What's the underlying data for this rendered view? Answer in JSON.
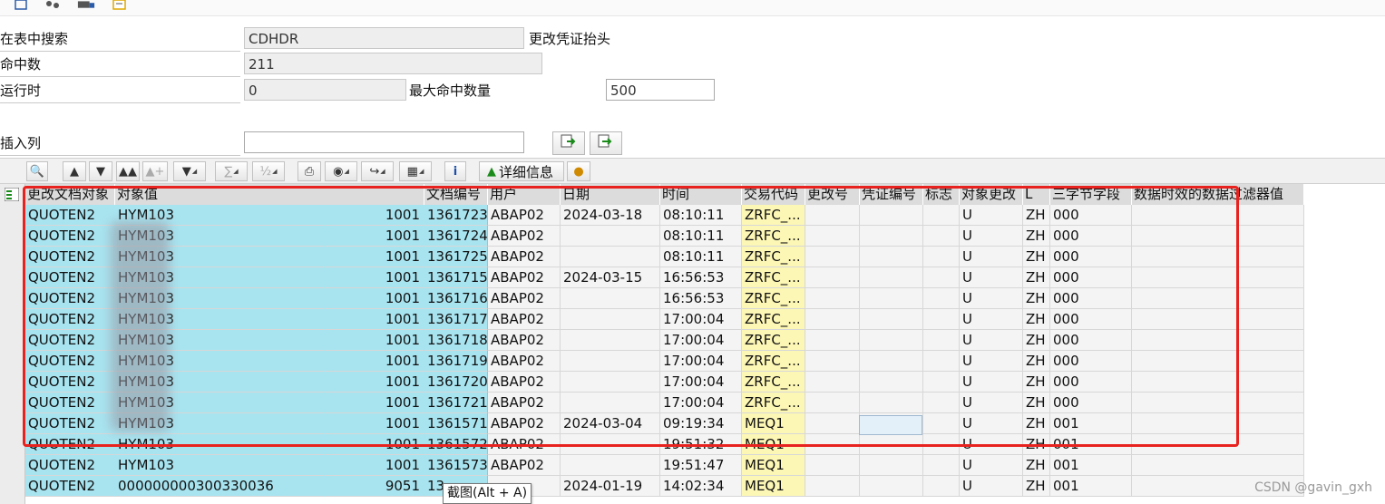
{
  "top_toolbar": {
    "icons": [
      "save-icon",
      "settings-icon",
      "transport-icon",
      "document-icon"
    ]
  },
  "form": {
    "search_table_label": "在表中搜索",
    "search_table_value": "CDHDR",
    "search_table_desc": "更改凭证抬头",
    "hits_label": "命中数",
    "hits_value": "211",
    "runtime_label": "运行时",
    "runtime_value": "0",
    "max_hits_label": "最大命中数量",
    "max_hits_value": "500",
    "insert_col_label": "插入列",
    "insert_col_value": ""
  },
  "alv_toolbar": {
    "buttons": [
      "details-icon",
      "sort-asc-icon",
      "sort-desc-icon",
      "find-icon",
      "find-next-icon",
      "filter-icon",
      "sum-icon",
      "subtotal-icon",
      "print-icon",
      "view-icon",
      "export-icon",
      "layout-icon",
      "info-icon",
      "chart-icon",
      "abc-icon"
    ],
    "details_label": "详细信息"
  },
  "table": {
    "headers": [
      "更改文档对象",
      "对象值",
      "文档编号",
      "用户",
      "日期",
      "时间",
      "交易代码",
      "更改号",
      "凭证编号",
      "标志",
      "对象更改",
      "L",
      "三字节字段",
      "数据时效的数据过滤器值"
    ],
    "rows": [
      {
        "obj": "QUOTEN2",
        "val1": "HYM103",
        "val2": "1001",
        "doc": "1361723",
        "user": "ABAP02",
        "date": "2024-03-18",
        "time": "08:10:11",
        "tcode": "ZRFC_...",
        "chg": "",
        "voucher": "",
        "flag": "",
        "objchg": "U",
        "lang": "ZH",
        "tri": "000",
        "filter": ""
      },
      {
        "obj": "QUOTEN2",
        "val1": "HYM103",
        "val2": "1001",
        "doc": "1361724",
        "user": "ABAP02",
        "date": "",
        "time": "08:10:11",
        "tcode": "ZRFC_...",
        "chg": "",
        "voucher": "",
        "flag": "",
        "objchg": "U",
        "lang": "ZH",
        "tri": "000",
        "filter": ""
      },
      {
        "obj": "QUOTEN2",
        "val1": "HYM103",
        "val2": "1001",
        "doc": "1361725",
        "user": "ABAP02",
        "date": "",
        "time": "08:10:11",
        "tcode": "ZRFC_...",
        "chg": "",
        "voucher": "",
        "flag": "",
        "objchg": "U",
        "lang": "ZH",
        "tri": "000",
        "filter": ""
      },
      {
        "obj": "QUOTEN2",
        "val1": "HYM103",
        "val2": "1001",
        "doc": "1361715",
        "user": "ABAP02",
        "date": "2024-03-15",
        "time": "16:56:53",
        "tcode": "ZRFC_...",
        "chg": "",
        "voucher": "",
        "flag": "",
        "objchg": "U",
        "lang": "ZH",
        "tri": "000",
        "filter": ""
      },
      {
        "obj": "QUOTEN2",
        "val1": "HYM103",
        "val2": "1001",
        "doc": "1361716",
        "user": "ABAP02",
        "date": "",
        "time": "16:56:53",
        "tcode": "ZRFC_...",
        "chg": "",
        "voucher": "",
        "flag": "",
        "objchg": "U",
        "lang": "ZH",
        "tri": "000",
        "filter": ""
      },
      {
        "obj": "QUOTEN2",
        "val1": "HYM103",
        "val2": "1001",
        "doc": "1361717",
        "user": "ABAP02",
        "date": "",
        "time": "17:00:04",
        "tcode": "ZRFC_...",
        "chg": "",
        "voucher": "",
        "flag": "",
        "objchg": "U",
        "lang": "ZH",
        "tri": "000",
        "filter": ""
      },
      {
        "obj": "QUOTEN2",
        "val1": "HYM103",
        "val2": "1001",
        "doc": "1361718",
        "user": "ABAP02",
        "date": "",
        "time": "17:00:04",
        "tcode": "ZRFC_...",
        "chg": "",
        "voucher": "",
        "flag": "",
        "objchg": "U",
        "lang": "ZH",
        "tri": "000",
        "filter": ""
      },
      {
        "obj": "QUOTEN2",
        "val1": "HYM103",
        "val2": "1001",
        "doc": "1361719",
        "user": "ABAP02",
        "date": "",
        "time": "17:00:04",
        "tcode": "ZRFC_...",
        "chg": "",
        "voucher": "",
        "flag": "",
        "objchg": "U",
        "lang": "ZH",
        "tri": "000",
        "filter": ""
      },
      {
        "obj": "QUOTEN2",
        "val1": "HYM103",
        "val2": "1001",
        "doc": "1361720",
        "user": "ABAP02",
        "date": "",
        "time": "17:00:04",
        "tcode": "ZRFC_...",
        "chg": "",
        "voucher": "",
        "flag": "",
        "objchg": "U",
        "lang": "ZH",
        "tri": "000",
        "filter": ""
      },
      {
        "obj": "QUOTEN2",
        "val1": "HYM103",
        "val2": "1001",
        "doc": "1361721",
        "user": "ABAP02",
        "date": "",
        "time": "17:00:04",
        "tcode": "ZRFC_...",
        "chg": "",
        "voucher": "",
        "flag": "",
        "objchg": "U",
        "lang": "ZH",
        "tri": "000",
        "filter": ""
      },
      {
        "obj": "QUOTEN2",
        "val1": "HYM103",
        "val2": "1001",
        "doc": "1361571",
        "user": "ABAP02",
        "date": "2024-03-04",
        "time": "09:19:34",
        "tcode": "MEQ1",
        "chg": "",
        "voucher": "",
        "flag": "",
        "objchg": "U",
        "lang": "ZH",
        "tri": "001",
        "filter": ""
      },
      {
        "obj": "QUOTEN2",
        "val1": "HYM103",
        "val2": "1001",
        "doc": "1361572",
        "user": "ABAP02",
        "date": "",
        "time": "19:51:32",
        "tcode": "MEQ1",
        "chg": "",
        "voucher": "",
        "flag": "",
        "objchg": "U",
        "lang": "ZH",
        "tri": "001",
        "filter": ""
      },
      {
        "obj": "QUOTEN2",
        "val1": "HYM103",
        "val2": "1001",
        "doc": "1361573",
        "user": "ABAP02",
        "date": "",
        "time": "19:51:47",
        "tcode": "MEQ1",
        "chg": "",
        "voucher": "",
        "flag": "",
        "objchg": "U",
        "lang": "ZH",
        "tri": "001",
        "filter": ""
      },
      {
        "obj": "QUOTEN2",
        "val1": "000000000300330036",
        "val2": "9051",
        "doc": "13",
        "user": "",
        "date": "2024-01-19",
        "time": "14:02:34",
        "tcode": "MEQ1",
        "chg": "",
        "voucher": "",
        "flag": "",
        "objchg": "U",
        "lang": "ZH",
        "tri": "001",
        "filter": ""
      }
    ]
  },
  "tooltip": "截图(Alt + A)",
  "watermark": "CSDN @gavin_gxh",
  "colors": {
    "key_column": "#a8e4f0",
    "tcode_column": "#fdf7b6",
    "highlight_box": "#e8231f",
    "header": "#dcdcdc"
  }
}
